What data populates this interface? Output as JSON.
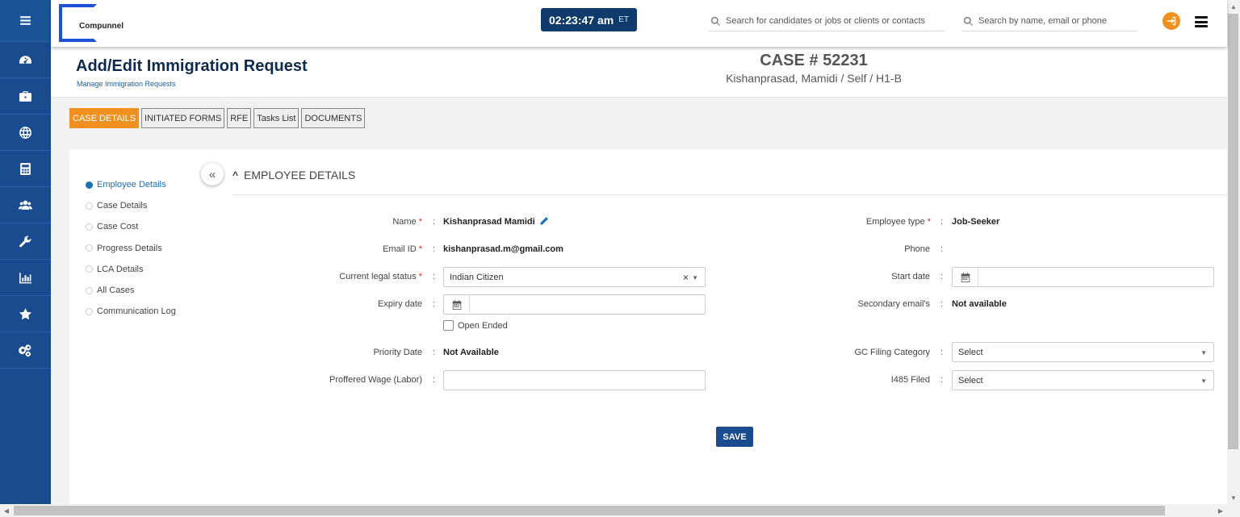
{
  "app": {
    "logo_text": "Compunnel",
    "clock_time": "02:23:47 am",
    "clock_tz": "ET"
  },
  "header": {
    "search1_placeholder": "Search for candidates or jobs or clients or contacts",
    "search2_placeholder": "Search by name, email or phone"
  },
  "page": {
    "title": "Add/Edit Immigration Request",
    "subtitle": "Manage Immigration Requests",
    "case_number": "CASE # 52231",
    "case_sub": "Kishanprasad, Mamidi / Self / H1-B"
  },
  "tabs": [
    "CASE DETAILS",
    "INITIATED FORMS",
    "RFE",
    "Tasks List",
    "DOCUMENTS"
  ],
  "steps": [
    "Employee Details",
    "Case Details",
    "Case Cost",
    "Progress Details",
    "LCA Details",
    "All Cases",
    "Communication Log"
  ],
  "section": {
    "title": "EMPLOYEE DETAILS",
    "collapse_icon": "«",
    "expand_icon": "^"
  },
  "form": {
    "name_label": "Name",
    "name_value": "Kishanprasad Mamidi",
    "email_label": "Email ID",
    "email_value": "kishanprasad.m@gmail.com",
    "legal_label": "Current legal status",
    "legal_value": "Indian Citizen",
    "expiry_label": "Expiry date",
    "open_ended_label": "Open Ended",
    "priority_label": "Priority Date",
    "priority_value": "Not Available",
    "wage_label": "Proffered Wage (Labor)",
    "emptype_label": "Employee type",
    "emptype_value": "Job-Seeker",
    "phone_label": "Phone",
    "start_label": "Start date",
    "secemail_label": "Secondary email's",
    "secemail_value": "Not available",
    "gc_label": "GC Filing Category",
    "gc_value": "Select",
    "i485_label": "I485 Filed",
    "i485_value": "Select",
    "required_mark": "*",
    "colon": ":",
    "save_label": "SAVE"
  },
  "colors": {
    "sidebar": "#1b4b8f",
    "accent": "#f0901e",
    "title": "#0e2a4d",
    "link": "#1a6fb7"
  }
}
